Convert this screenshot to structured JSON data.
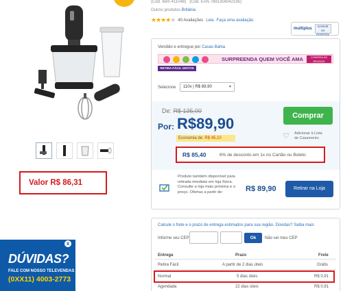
{
  "colors": {
    "accent_blue": "#1a4d8f",
    "buy_green": "#3fb44c",
    "highlight_red": "#d4191c",
    "banner_blue": "#0f5aa8"
  },
  "product": {
    "cod_item": "(Cód. Item 411048)",
    "cod_ean": "(Cód. EAN 7891356042195)",
    "outros_label": "Outros produtos",
    "brand": "Britânia",
    "rating_stars": 4,
    "reviews": "40 Avaliações",
    "read_link": "Leia",
    "write_link": "Faça uma avaliação",
    "thumbnails": [
      "blender-thumb-1",
      "blender-thumb-2",
      "cup-thumb",
      "whisk-thumb"
    ],
    "annotation_valor": "Valor R$ 86,31"
  },
  "multiplus": {
    "logo": "multiplus",
    "badge": "GANHE 44 PONTOS"
  },
  "seller": {
    "label": "Vendido e entregue por",
    "name": "Casas Bahia"
  },
  "promo": {
    "text": "SURPREENDA QUEM VOCÊ AMA",
    "button": "CONFIRA AS REGRAS"
  },
  "retira_badge": "RETIRA FÁCIL GRÁTIS",
  "variant": {
    "label": "Selecione",
    "selected": "110v | R$ 89,90"
  },
  "pricing": {
    "de_label": "De:",
    "old_price": "R$ 135,00",
    "por_label": "Por:",
    "price": "R$89,90",
    "economia_label": "Economia de:",
    "economia_value": "R$ 45,10",
    "cartao_value": "R$ 85,40",
    "cartao_desc": "6% de desconto em 1x no Cartão ou Boleto"
  },
  "buy_button": "Comprar",
  "wishlist": {
    "line1": "Adicionar à Lista",
    "line2": "de Casamento"
  },
  "store_pickup": {
    "text": "Produto também disponível para retirada imediata em loja física. Consulte a loja mais próxima e o preço. Ofertas a partir de:",
    "price": "R$ 89,90",
    "button": "Retirar na Loja"
  },
  "shipping": {
    "calc_text": "Calcule o frete e o prazo de entrega estimados para sua região.",
    "calc_link": "Dúvidas? Saiba mais",
    "cep_label": "Informe seu CEP:",
    "ok_button": "Ok",
    "nosei": "Não sei meu CEP",
    "headers": {
      "entrega": "Entrega",
      "prazo": "Prazo",
      "frete": "Frete"
    },
    "rows": [
      {
        "name": "Retira Fácil",
        "prazo": "A partir de 2 dias úteis",
        "frete": "Grátis"
      },
      {
        "name": "Normal",
        "prazo": "5 dias úteis",
        "frete": "R$ 0,91"
      },
      {
        "name": "Agendada",
        "prazo": "22 dias úteis",
        "frete": "R$ 0,91"
      }
    ]
  },
  "help_banner": {
    "title": "DÚVIDAS?",
    "line1": "FALE COM NOSSO TELEVENDAS",
    "phone": "(0XX11) 4003-2773",
    "close": "x"
  }
}
